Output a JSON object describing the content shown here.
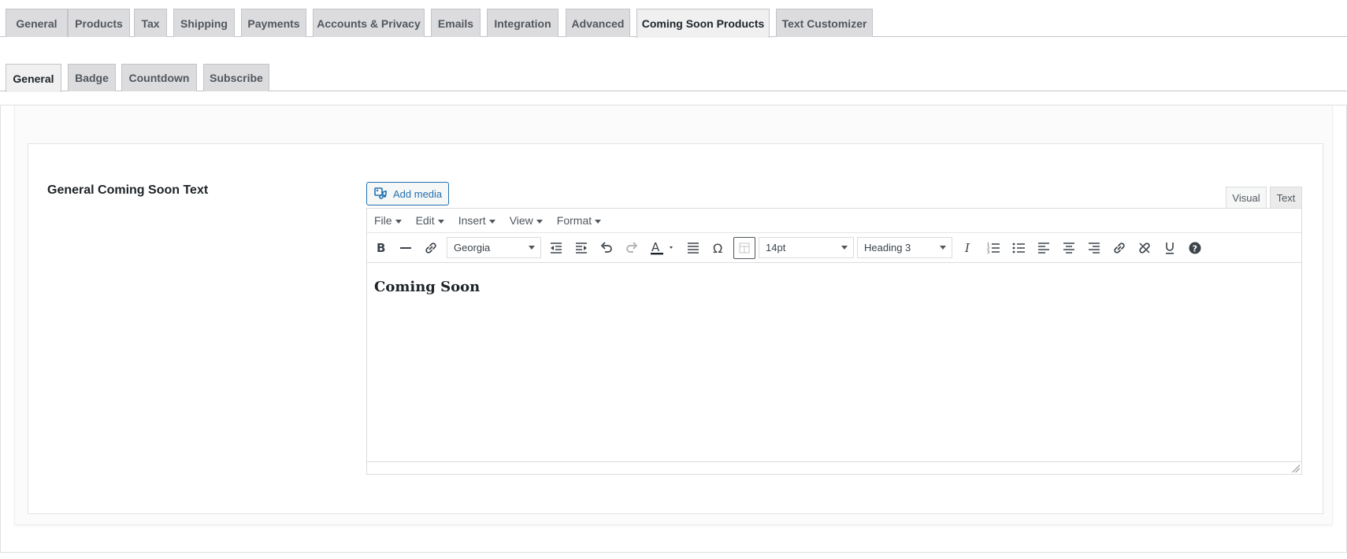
{
  "main_tabs": [
    {
      "label": "General"
    },
    {
      "label": "Products"
    },
    {
      "label": "Tax"
    },
    {
      "label": "Shipping"
    },
    {
      "label": "Payments"
    },
    {
      "label": "Accounts & Privacy"
    },
    {
      "label": "Emails"
    },
    {
      "label": "Integration"
    },
    {
      "label": "Advanced"
    },
    {
      "label": "Coming Soon Products",
      "active": true
    },
    {
      "label": "Text Customizer"
    }
  ],
  "sub_tabs": [
    {
      "label": "General",
      "active": true
    },
    {
      "label": "Badge"
    },
    {
      "label": "Countdown"
    },
    {
      "label": "Subscribe"
    }
  ],
  "field": {
    "label": "General Coming Soon Text"
  },
  "editor": {
    "add_media_label": "Add media",
    "mode_tabs": {
      "visual": "Visual",
      "text": "Text",
      "active": "visual"
    },
    "menus": [
      "File",
      "Edit",
      "Insert",
      "View",
      "Format"
    ],
    "font_family": "Georgia",
    "font_size": "14pt",
    "block_format": "Heading 3",
    "content_heading": "Coming Soon",
    "toolbar_icons": [
      "bold-icon",
      "horizontal-rule-icon",
      "link-icon",
      "font-family-select",
      "outdent-icon",
      "indent-icon",
      "undo-icon",
      "redo-icon",
      "text-color-icon",
      "justify-icon",
      "special-character-icon",
      "table-icon",
      "font-size-select",
      "format-select",
      "italic-icon",
      "numbered-list-icon",
      "bullet-list-icon",
      "align-left-icon",
      "align-center-icon",
      "align-right-icon",
      "insert-link-icon",
      "unlink-icon",
      "underline-icon",
      "help-icon"
    ]
  },
  "colors": {
    "accent": "#2271b1",
    "tab_bg": "#dcdcde",
    "tab_active_bg": "#f0f0f1",
    "border": "#c3c4c7"
  }
}
